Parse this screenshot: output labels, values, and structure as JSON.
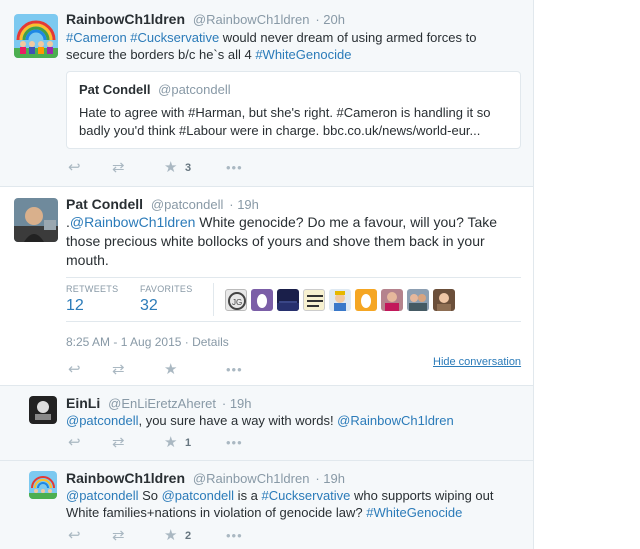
{
  "tweet1": {
    "name": "RainbowCh1ldren",
    "handle": "@RainbowCh1ldren",
    "time": "· 20h",
    "text_part1": "#Cameron #Cuckservative",
    "text_part2": " would never dream of using armed forces to secure the borders b/c he`s all 4 ",
    "text_part3": "#WhiteGenocide",
    "quote": {
      "name": "Pat Condell",
      "handle": "@patcondell",
      "text": "Hate to agree with #Harman, but she's right. #Cameron is handling it so badly you'd think #Labour were in charge. bbc.co.uk/news/world-eur..."
    },
    "fav_count": "3"
  },
  "tweet2": {
    "name": "Pat Condell",
    "handle": "@patcondell",
    "time": "· 19h",
    "text_prefix": ".",
    "text_mention": "@RainbowCh1ldren",
    "text_body": " White genocide? Do me a favour, will you? Take those precious white bollocks of yours and shove them back in your mouth.",
    "retweets_label": "RETWEETS",
    "retweets_value": "12",
    "favorites_label": "FAVORITES",
    "favorites_value": "32",
    "timestamp": "8:25 AM - 1 Aug 2015",
    "details": "· Details",
    "hide_conversation": "Hide conversation"
  },
  "reply1": {
    "name": "EinLi",
    "handle": "@EnLiEretzAheret",
    "time": "· 19h",
    "mention1": "@patcondell",
    "text_mid": ", you sure have a way with words! ",
    "mention2": "@RainbowCh1ldren",
    "fav_count": "1"
  },
  "reply2": {
    "name": "RainbowCh1ldren",
    "handle": "@RainbowCh1ldren",
    "time": "· 19h",
    "mention1": "@patcondell",
    "text_a": " So ",
    "mention2": "@patcondell",
    "text_b": " is a ",
    "hashtag1": "#Cuckservative",
    "text_c": " who supports wiping out White families+nations in violation of genocide law? ",
    "hashtag2": "#WhiteGenocide",
    "fav_count": "2"
  },
  "colors": {
    "link": "#2b7bb9",
    "muted": "#8899a6",
    "icon": "#aab8c2",
    "grey_bg": "#f5f8fa"
  }
}
